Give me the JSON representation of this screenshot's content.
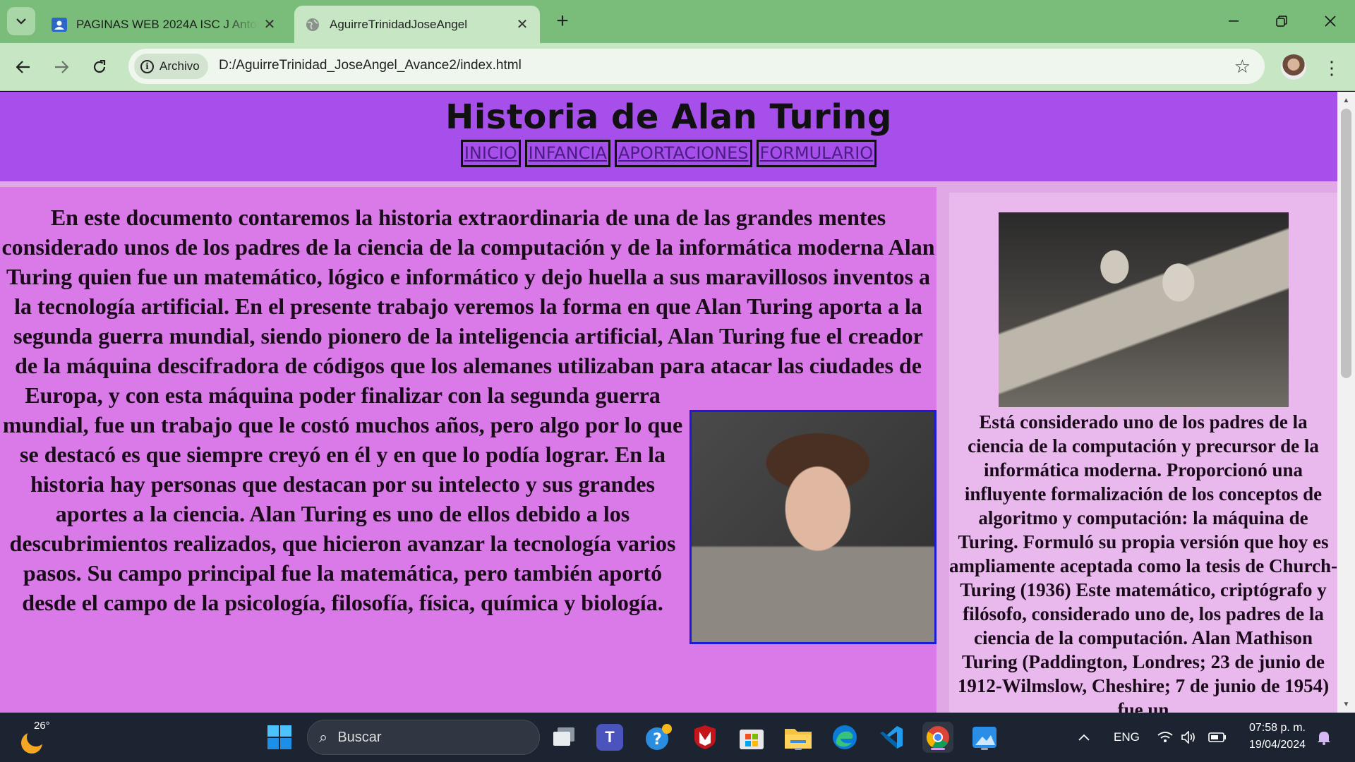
{
  "browser": {
    "tabs": [
      {
        "title": "PAGINAS WEB 2024A ISC J Antonio",
        "icon": "classroom-icon",
        "active": false
      },
      {
        "title": "AguirreTrinidadJoseAngel",
        "icon": "globe-icon",
        "active": true
      }
    ],
    "omnibox": {
      "chip_label": "Archivo",
      "url": "D:/AguirreTrinidad_JoseAngel_Avance2/index.html"
    },
    "colors": {
      "frame": "#7abd7a",
      "toolbar": "#c6e6c4"
    }
  },
  "page": {
    "title": "Historia de Alan Turing",
    "nav": [
      "INICIO",
      "INFANCIA",
      "APORTACIONES",
      "FORMULARIO"
    ],
    "main_text": "En este documento contaremos la historia extraordinaria de una de las grandes mentes considerado unos de los padres de la ciencia de la computación y de la informática moderna Alan Turing quien fue un matemático, lógico e informático y dejo huella a sus maravillosos inventos a la tecnología artificial. En el presente trabajo veremos la forma en que Alan Turing aporta a la segunda guerra mundial, siendo pionero de la inteligencia artificial, Alan Turing fue el creador de la máquina descifradora de códigos que los alemanes utilizaban para atacar las ciudades de Europa, y con esta máquina poder finalizar con la segunda guerra mundial, fue un trabajo que le costó muchos años, pero algo por lo que se destacó es que siempre creyó en él y en que lo podía lograr. En la historia hay personas que destacan por su intelecto y sus grandes aportes a la ciencia. Alan Turing es uno de ellos debido a los descubrimientos realizados, que hicieron avanzar la tecnología varios pasos. Su campo principal fue la matemática, pero también aportó desde el campo de la psicología, filosofía, física, química y biología.",
    "sidebar_text": "Está considerado uno de los padres de la ciencia de la computación y precursor de la informática moderna. Proporcionó una influyente formalización de los conceptos de algoritmo y computación: la máquina de Turing. Formuló su propia versión que hoy es ampliamente aceptada como la tesis de Church-Turing (1936) Este matemático, criptógrafo y filósofo, considerado uno de, los padres de la ciencia de la computación. Alan Mathison Turing (Paddington, Londres; 23 de junio de 1912-Wilmslow, Cheshire; 7 de junio de 1954) fue un",
    "colors": {
      "header": "#a74feb",
      "main": "#d97ae8",
      "sidebar": "#e9b9ee",
      "photo_border": "#1b1bd8"
    }
  },
  "taskbar": {
    "weather_temp": "26°",
    "search_placeholder": "Buscar",
    "language": "ENG",
    "time": "07:58 p. m.",
    "date": "19/04/2024",
    "apps": [
      "task-view-icon",
      "teams-icon",
      "tips-icon",
      "mcafee-icon",
      "store-icon",
      "file-explorer-icon",
      "edge-icon",
      "vscode-icon",
      "chrome-icon",
      "photos-icon"
    ]
  }
}
